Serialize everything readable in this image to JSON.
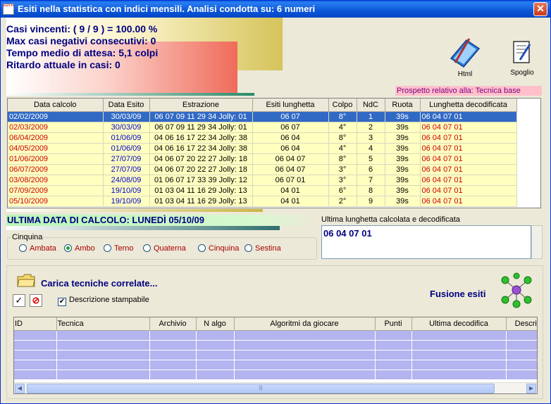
{
  "window": {
    "title": "Esiti nella statistica con indici mensili. Analisi condotta su: 6 numeri",
    "close_label": "✕",
    "icon_text": "LOTTO"
  },
  "stats": {
    "line1": "Casi vincenti: ( 9 / 9 ) = 100.00 %",
    "line2": "Max casi negativi consecutivi: 0",
    "line3": "Tempo medio di attesa: 5,1 colpi",
    "line4": "Ritardo attuale in casi: 0"
  },
  "toolbar": {
    "html_label": "Html",
    "spoglio_label": "Spoglio"
  },
  "prospetto": "Prospetto relativo alla: Tecnica base",
  "main_table": {
    "headers": [
      "Data calcolo",
      "Data Esito",
      "Estrazione",
      "Esiti lunghetta",
      "Colpo",
      "NdC",
      "Ruota",
      "Lunghetta decodificata"
    ],
    "rows": [
      [
        "02/02/2009",
        "30/03/09",
        "06 07 09 11 29 34 Jolly: 01",
        "06 07",
        "8°",
        "1",
        "39s",
        "06 04 07 01"
      ],
      [
        "02/03/2009",
        "30/03/09",
        "06 07 09 11 29 34 Jolly: 01",
        "06 07",
        "4°",
        "2",
        "39s",
        "06 04 07 01"
      ],
      [
        "06/04/2009",
        "01/06/09",
        "04 06 16 17 22 34 Jolly: 38",
        "06 04",
        "8°",
        "3",
        "39s",
        "06 04 07 01"
      ],
      [
        "04/05/2009",
        "01/06/09",
        "04 06 16 17 22 34 Jolly: 38",
        "06 04",
        "4°",
        "4",
        "39s",
        "06 04 07 01"
      ],
      [
        "01/06/2009",
        "27/07/09",
        "04 06 07 20 22 27 Jolly: 18",
        "06 04 07",
        "8°",
        "5",
        "39s",
        "06 04 07 01"
      ],
      [
        "06/07/2009",
        "27/07/09",
        "04 06 07 20 22 27 Jolly: 18",
        "06 04 07",
        "3°",
        "6",
        "39s",
        "06 04 07 01"
      ],
      [
        "03/08/2009",
        "24/08/09",
        "01 06 07 17 33 39 Jolly: 12",
        "06 07 01",
        "3°",
        "7",
        "39s",
        "06 04 07 01"
      ],
      [
        "07/09/2009",
        "19/10/09",
        "01 03 04 11 16 29 Jolly: 13",
        "04 01",
        "6°",
        "8",
        "39s",
        "06 04 07 01"
      ],
      [
        "05/10/2009",
        "19/10/09",
        "01 03 04 11 16 29 Jolly: 13",
        "04 01",
        "2°",
        "9",
        "39s",
        "06 04 07 01"
      ]
    ]
  },
  "ultima_data": "ULTIMA DATA DI CALCOLO: LUNEDÌ 05/10/09",
  "ultima_lunghetta_label": "Ultima lunghetta calcolata e decodificata",
  "ultima_lunghetta_value": "06 04 07 01",
  "cinquina": {
    "legend": "Cinquina",
    "options": [
      "Ambata",
      "Ambo",
      "Terno",
      "Quaterna",
      "Cinquina",
      "Sestina"
    ],
    "selected": "Ambo"
  },
  "lower": {
    "carica_label": "Carica tecniche correlate...",
    "check_icon": "✓",
    "stop_icon": "⊘",
    "descrizione_label": "Descrizione stampabile",
    "descrizione_checked": "✔",
    "fusione_label": "Fusione esiti",
    "table_headers": [
      "ID",
      "Tecnica",
      "Archivio",
      "N algo",
      "Algoritmi da giocare",
      "Punti",
      "Ultima decodifica",
      "Descriz"
    ],
    "scroll_grip": "|||"
  },
  "colors": {
    "selected_row": "#316ac5",
    "row_bg": "#ffffc0",
    "date_red": "#cc0000",
    "date_blue": "#0000cc",
    "title_blue": "#000080"
  }
}
